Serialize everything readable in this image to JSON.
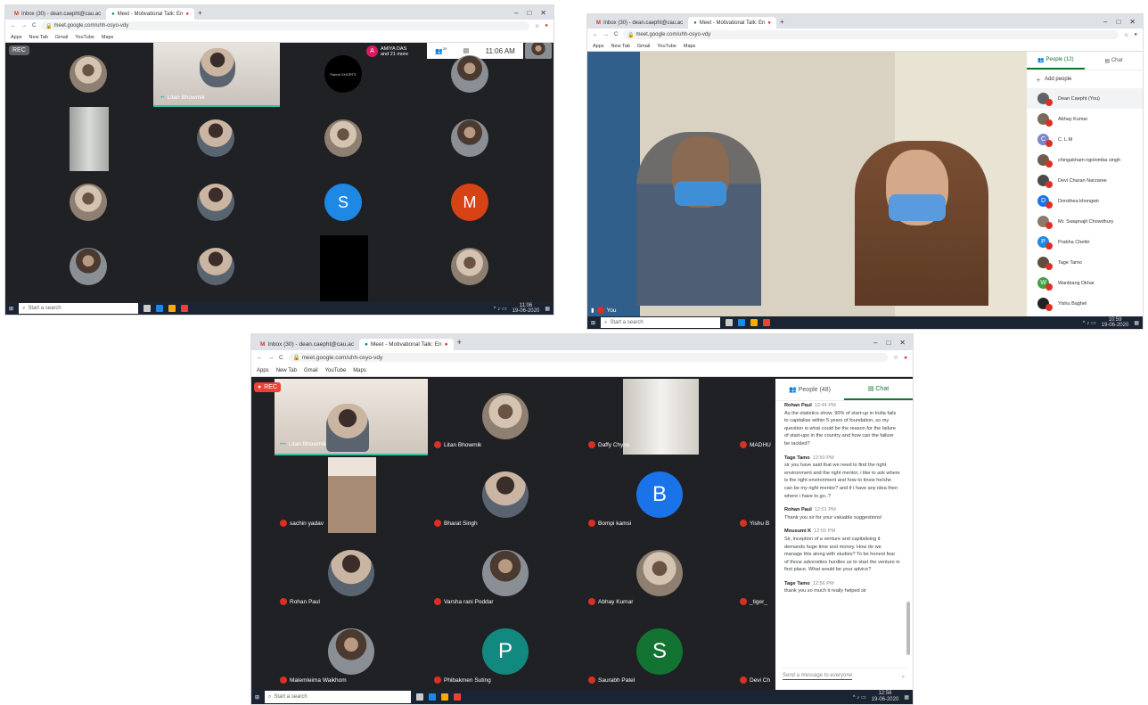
{
  "shot1": {
    "tabs": [
      "Inbox (30) - dean.caepht@cau.ac",
      "Meet - Motivational Talk: En"
    ],
    "url": "meet.google.com/uhh-osyo-vdy",
    "bookmarks": [
      "Apps",
      "New Tab",
      "Gmail",
      "YouTube",
      "Maps"
    ],
    "rec": "REC",
    "presenter": "Litan Bhowmik",
    "joined_initial": "A",
    "joined_name": "AMIYA DAS",
    "joined_more": "and 21 more",
    "participants_badge": "29",
    "clock": "11:06 AM",
    "tile_initials": [
      "S",
      "M"
    ],
    "logo_text": "Patent SHORTS",
    "search_placeholder": "Start a search",
    "taskbar_time": "11:06",
    "taskbar_date": "19-06-2020"
  },
  "shot2": {
    "tabs": [
      "Inbox (30) - dean.caepht@cau.ac",
      "Meet - Motivational Talk: En"
    ],
    "url": "meet.google.com/uhh-osyo-vdy",
    "bookmarks": [
      "Apps",
      "New Tab",
      "Gmail",
      "YouTube",
      "Maps"
    ],
    "people_tab": "People (12)",
    "chat_tab": "Chat",
    "add_people": "Add people",
    "people": [
      {
        "name": "Dean Caepht (You)",
        "initial": "",
        "color": "#5f6368"
      },
      {
        "name": "Abhay Kumar",
        "initial": "",
        "color": "#7a6a5a"
      },
      {
        "name": "C. L.M",
        "initial": "C",
        "color": "#7986cb"
      },
      {
        "name": "chingakham ngolomba singh",
        "initial": "",
        "color": "#6d5c4d"
      },
      {
        "name": "Devi Charan Narzaree",
        "initial": "",
        "color": "#4a4a4a"
      },
      {
        "name": "Dorothea khongwir",
        "initial": "D",
        "color": "#1a73e8"
      },
      {
        "name": "Mr. Swapnajit Chowdhury",
        "initial": "",
        "color": "#8a7a6a"
      },
      {
        "name": "Prabha Chettri",
        "initial": "P",
        "color": "#1e88e5"
      },
      {
        "name": "Tage Tamo",
        "initial": "",
        "color": "#5d4e3f"
      },
      {
        "name": "Wanbiang Dkhar",
        "initial": "W",
        "color": "#43a047"
      },
      {
        "name": "Yishu Baghel",
        "initial": "",
        "color": "#222222"
      }
    ],
    "you_label": "You",
    "search_placeholder": "Start a search",
    "taskbar_time": "10:59",
    "taskbar_date": "19-06-2020"
  },
  "shot3": {
    "tabs": [
      "Inbox (30) - dean.caepht@cau.ac",
      "Meet - Motivational Talk: En"
    ],
    "url": "meet.google.com/uhh-osyo-vdy",
    "bookmarks": [
      "Apps",
      "New Tab",
      "Gmail",
      "YouTube",
      "Maps"
    ],
    "rec": "REC",
    "people_tab": "People (48)",
    "chat_tab": "Chat",
    "tiles": [
      {
        "name": "Litan Bhowmik",
        "kind": "video"
      },
      {
        "name": "Litan Bhowmik",
        "kind": "photo"
      },
      {
        "name": "Daffy Chyne",
        "kind": "video2"
      },
      {
        "name": "MADHU",
        "kind": "cut"
      },
      {
        "name": "sachin yadav",
        "kind": "video3"
      },
      {
        "name": "Bharat Singh",
        "kind": "photo"
      },
      {
        "name": "Bompi kamsi",
        "kind": "initial",
        "initial": "B",
        "color": "#1a73e8"
      },
      {
        "name": "Yishu B",
        "kind": "cut"
      },
      {
        "name": "Rohan Paul",
        "kind": "photo"
      },
      {
        "name": "Varsha rani Poddar",
        "kind": "photo"
      },
      {
        "name": "Abhay Kumar",
        "kind": "photo"
      },
      {
        "name": "_tiger_",
        "kind": "cut"
      },
      {
        "name": "Malemleima Waikhom",
        "kind": "photo"
      },
      {
        "name": "Phibakmen Suting",
        "kind": "initial",
        "initial": "P",
        "color": "#12897f"
      },
      {
        "name": "Saurabh Patel",
        "kind": "initial",
        "initial": "S",
        "color": "#137333"
      },
      {
        "name": "Devi Ch",
        "kind": "cut"
      }
    ],
    "chat": [
      {
        "who": "Rohan Paul",
        "time": "12:44 PM",
        "text": "As the statistics show, 90% of start-up in India fails to capitalise within 5 years of foundation, so my question is what could be the reason for the failure of start-ups in the country and how can the failure be tackled?"
      },
      {
        "who": "Tage Tamo",
        "time": "12:50 PM",
        "text": "sir you have said that we need to find the right environment and the right mentor, i like to ask where is the right environment and how to know he/she can be my right mentor? and if i have any idea then where i have to go..?"
      },
      {
        "who": "Rohan Paul",
        "time": "12:51 PM",
        "text": "Thank you sir for your valuable suggestions!"
      },
      {
        "who": "Mousumi K",
        "time": "12:55 PM",
        "text": "Sir, inception of a venture and capitalising it demands huge time and money. How do we manage this along with studies? To be honest fear of those adversities hurdles us to start the venture in first place. What would be your advice?"
      },
      {
        "who": "Tage Tamo",
        "time": "12:56 PM",
        "text": "thank you so much it really helped sir"
      }
    ],
    "message_placeholder": "Send a message to everyone",
    "search_placeholder": "Start a search",
    "taskbar_time": "12:56",
    "taskbar_date": "19-06-2020"
  }
}
